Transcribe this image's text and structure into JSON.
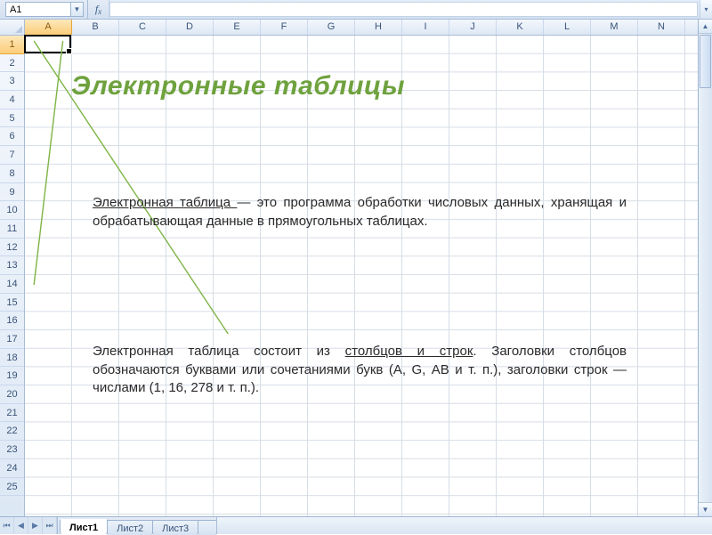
{
  "formula_bar": {
    "name_box": "A1",
    "fx_label_f": "f",
    "fx_label_x": "x"
  },
  "columns": [
    "A",
    "B",
    "C",
    "D",
    "E",
    "F",
    "G",
    "H",
    "I",
    "J",
    "K",
    "L",
    "M",
    "N"
  ],
  "selected_column_index": 0,
  "rows": [
    "1",
    "2",
    "3",
    "4",
    "5",
    "6",
    "7",
    "8",
    "9",
    "10",
    "11",
    "12",
    "13",
    "14",
    "15",
    "16",
    "17",
    "18",
    "19",
    "20",
    "21",
    "22",
    "23",
    "24",
    "25"
  ],
  "selected_row_index": 0,
  "content": {
    "title": "Электронные таблицы",
    "para1_u": "Электронная таблица ",
    "para1_rest": "— это программа обработки числовых данных, хранящая и обрабатывающая данные в прямоугольных таблицах.",
    "para2_a": "Электронная таблица состоит из ",
    "para2_u": "столбцов и строк",
    "para2_b": ". Заголовки столбцов обозначаются буквами или сочетаниями букв (A, G, АВ и т. п.), заголовки строк — числами (1, 16, 278 и т. п.)."
  },
  "sheet_tabs": {
    "items": [
      "Лист1",
      "Лист2",
      "Лист3"
    ],
    "active_index": 0
  },
  "colors": {
    "accent_green": "#6fa23e",
    "line_green": "#7fb547"
  }
}
